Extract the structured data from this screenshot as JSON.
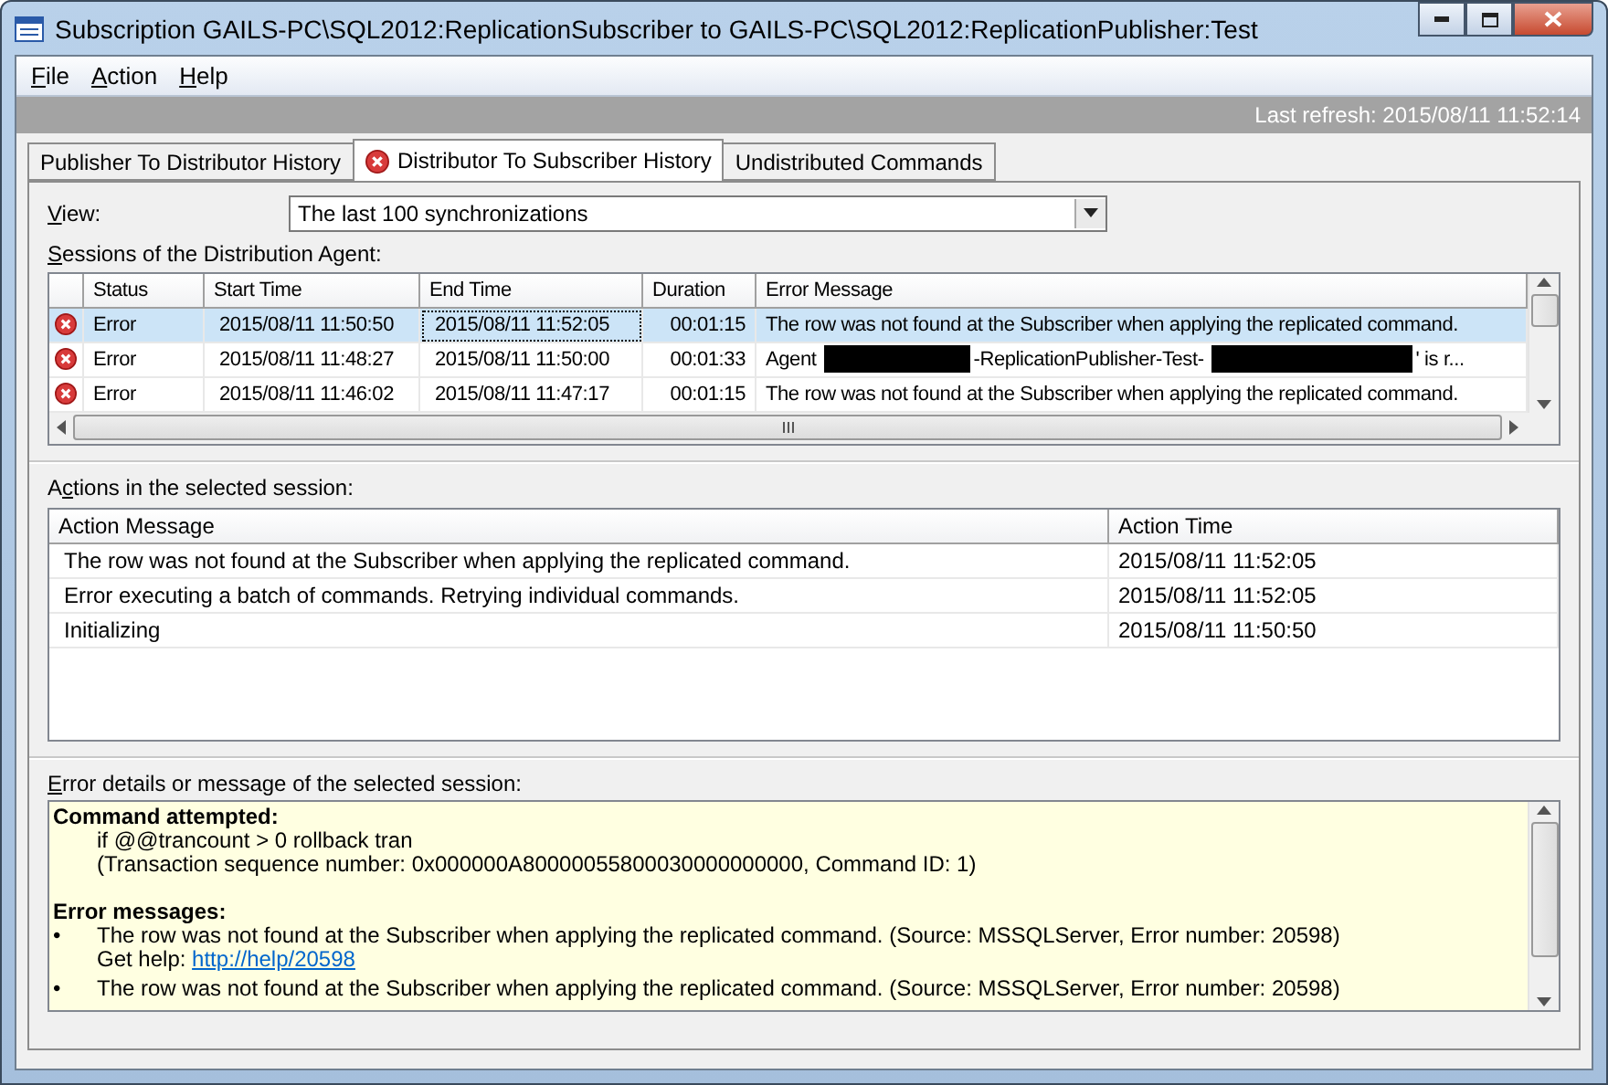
{
  "window": {
    "title": "Subscription GAILS-PC\\SQL2012:ReplicationSubscriber to GAILS-PC\\SQL2012:ReplicationPublisher:Test"
  },
  "menu": [
    {
      "label": "File"
    },
    {
      "label": "Action"
    },
    {
      "label": "Help"
    }
  ],
  "last_refresh": "Last refresh: 2015/08/11 11:52:14",
  "tabs": [
    {
      "label": "Publisher To Distributor History",
      "selected": false,
      "error": false
    },
    {
      "label": "Distributor To Subscriber History",
      "selected": true,
      "error": true
    },
    {
      "label": "Undistributed Commands",
      "selected": false,
      "error": false
    }
  ],
  "view": {
    "label": "View:",
    "value": "The last 100 synchronizations"
  },
  "sessions": {
    "label": "Sessions of the Distribution Agent:",
    "columns": [
      "Status",
      "Start Time",
      "End Time",
      "Duration",
      "Error Message"
    ],
    "rows": [
      {
        "selected": true,
        "status": "Error",
        "start": "2015/08/11 11:50:50",
        "end": "2015/08/11 11:52:05",
        "duration": "00:01:15",
        "message": [
          {
            "kind": "text",
            "text": "The row was not found at the Subscriber when applying the replicated command."
          }
        ]
      },
      {
        "selected": false,
        "status": "Error",
        "start": "2015/08/11 11:48:27",
        "end": "2015/08/11 11:50:00",
        "duration": "00:01:33",
        "message": [
          {
            "kind": "text",
            "text": "Agent"
          },
          {
            "kind": "redacted"
          },
          {
            "kind": "text",
            "text": "-ReplicationPublisher-Test-"
          },
          {
            "kind": "redacted_wide"
          },
          {
            "kind": "text",
            "text": "' is r..."
          }
        ]
      },
      {
        "selected": false,
        "status": "Error",
        "start": "2015/08/11 11:46:02",
        "end": "2015/08/11 11:47:17",
        "duration": "00:01:15",
        "message": [
          {
            "kind": "text",
            "text": "The row was not found at the Subscriber when applying the replicated command."
          }
        ]
      }
    ]
  },
  "actions": {
    "label": "Actions in the selected session:",
    "columns": [
      "Action Message",
      "Action Time"
    ],
    "rows": [
      {
        "message": "The row was not found at the Subscriber when applying the replicated command.",
        "time": "2015/08/11 11:52:05"
      },
      {
        "message": "Error executing a batch of commands. Retrying individual commands.",
        "time": "2015/08/11 11:52:05"
      },
      {
        "message": "Initializing",
        "time": "2015/08/11 11:50:50"
      }
    ]
  },
  "details": {
    "label": "Error details or message of the selected session:",
    "command_heading": "Command attempted:",
    "command": "if @@trancount > 0 rollback tran",
    "transaction": "(Transaction sequence number: 0x000000A80000055800030000000000, Command ID: 1)",
    "errors_heading": "Error messages:",
    "errors": [
      {
        "bullet": "•",
        "text": "The row was not found at the Subscriber when applying the replicated command. (Source: MSSQLServer, Error number: 20598)",
        "help_label": "Get help:",
        "help_link": "http://help/20598"
      },
      {
        "bullet": "•",
        "text": "The row was not found at the Subscriber when applying the replicated command. (Source: MSSQLServer, Error number: 20598)"
      }
    ]
  }
}
